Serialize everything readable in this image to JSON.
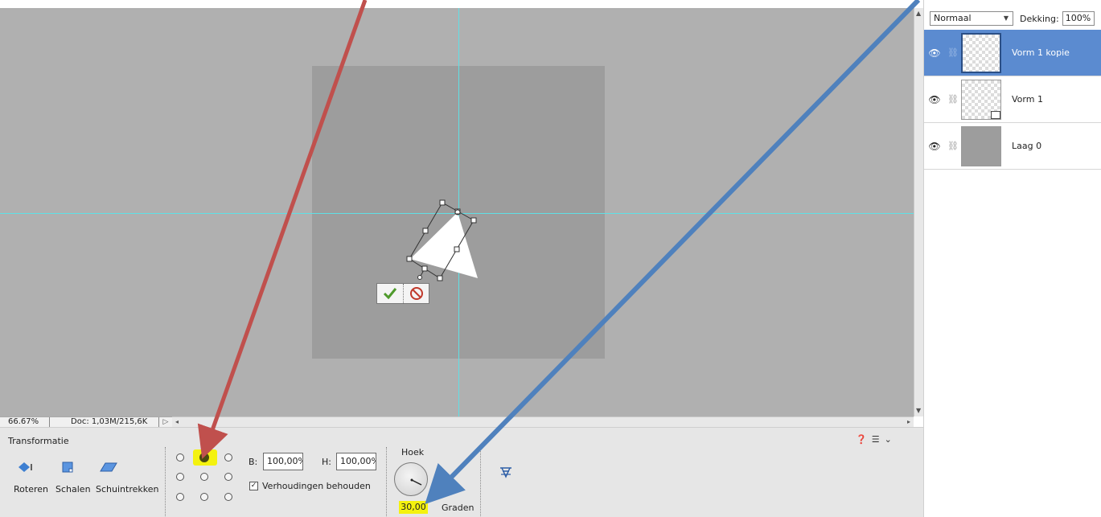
{
  "status_bar": {
    "zoom": "66.67%",
    "doc_size": "Doc: 1,03M/215,6K"
  },
  "layers_panel": {
    "blend_mode": "Normaal",
    "opacity_label": "Dekking:",
    "opacity_value": "100%",
    "layers": [
      {
        "name": "Vorm 1 kopie",
        "selected": true
      },
      {
        "name": "Vorm 1",
        "selected": false
      },
      {
        "name": "Laag 0",
        "selected": false
      }
    ]
  },
  "options_bar": {
    "title": "Transformatie",
    "tools": [
      {
        "label": "Roteren",
        "icon": "rotate-icon"
      },
      {
        "label": "Schalen",
        "icon": "scale-icon"
      },
      {
        "label": "Schuintrekken",
        "icon": "skew-icon"
      }
    ],
    "width_label": "B:",
    "width_value": "100,00%",
    "height_label": "H:",
    "height_value": "100,00%",
    "keep_ratio_label": "Verhoudingen behouden",
    "keep_ratio_checked": true,
    "angle_label": "Hoek",
    "angle_value": "30,00",
    "angle_unit": "Graden",
    "reference_point_active": 1
  },
  "colors": {
    "canvas_bg": "#b0b0b0",
    "document_bg": "#9d9d9d",
    "guide": "#5fe0e6",
    "selected_layer": "#5b8bd0",
    "highlight": "#f4f20f",
    "arrow_red": "#c0504d",
    "arrow_blue": "#4f81bd"
  }
}
